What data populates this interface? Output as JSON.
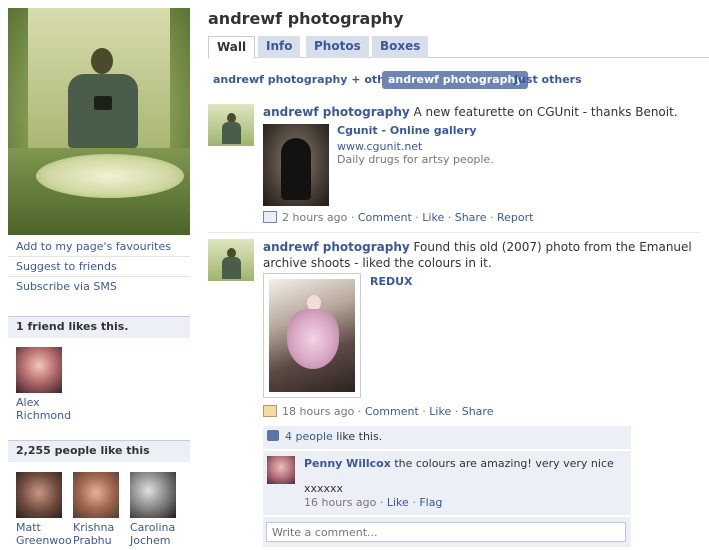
{
  "page": {
    "title": "andrewf photography"
  },
  "tabs": [
    "Wall",
    "Info",
    "Photos",
    "Boxes"
  ],
  "sidebar": {
    "links": [
      "Add to my page's favourites",
      "Suggest to friends",
      "Subscribe via SMS"
    ],
    "friends_box": {
      "heading": "1 friend likes this.",
      "friends": [
        "Alex Richmond"
      ]
    },
    "people_box": {
      "heading": "2,255 people like this",
      "people": [
        "Matt Greenwoo",
        "Krishna Prabhu",
        "Carolina Jochem"
      ]
    }
  },
  "filters": [
    "andrewf photography + others",
    "andrewf photography",
    "Just others"
  ],
  "posts": [
    {
      "author": "andrewf photography",
      "text": "A new featurette on CGUnit - thanks Benoit.",
      "attachment": {
        "title": "Cgunit - Online gallery",
        "url": "www.cgunit.net",
        "desc": "Daily drugs for artsy people."
      },
      "time": "2 hours ago",
      "actions": [
        "Comment",
        "Like",
        "Share",
        "Report"
      ]
    },
    {
      "author": "andrewf photography",
      "text_line1": "Found this old (2007) photo from the Emanuel",
      "text_line2": "archive shoots - liked the colours in it.",
      "attachment_title": "REDUX",
      "time": "18 hours ago",
      "actions": [
        "Comment",
        "Like",
        "Share"
      ],
      "likes": {
        "count": "4 people",
        "suffix": "like this."
      },
      "comment": {
        "author": "Penny Willcox",
        "text": "the colours are amazing! very very nice",
        "text2": "xxxxxx",
        "time": "16 hours ago",
        "actions": [
          "Like",
          "Flag"
        ]
      },
      "comment_placeholder": "Write a comment..."
    }
  ],
  "separator": "·",
  "colors": {
    "link": "#3b5998",
    "tab_bg": "#d8dfea",
    "filter_active": "#6d84b4",
    "box_bg": "#eceff5"
  }
}
